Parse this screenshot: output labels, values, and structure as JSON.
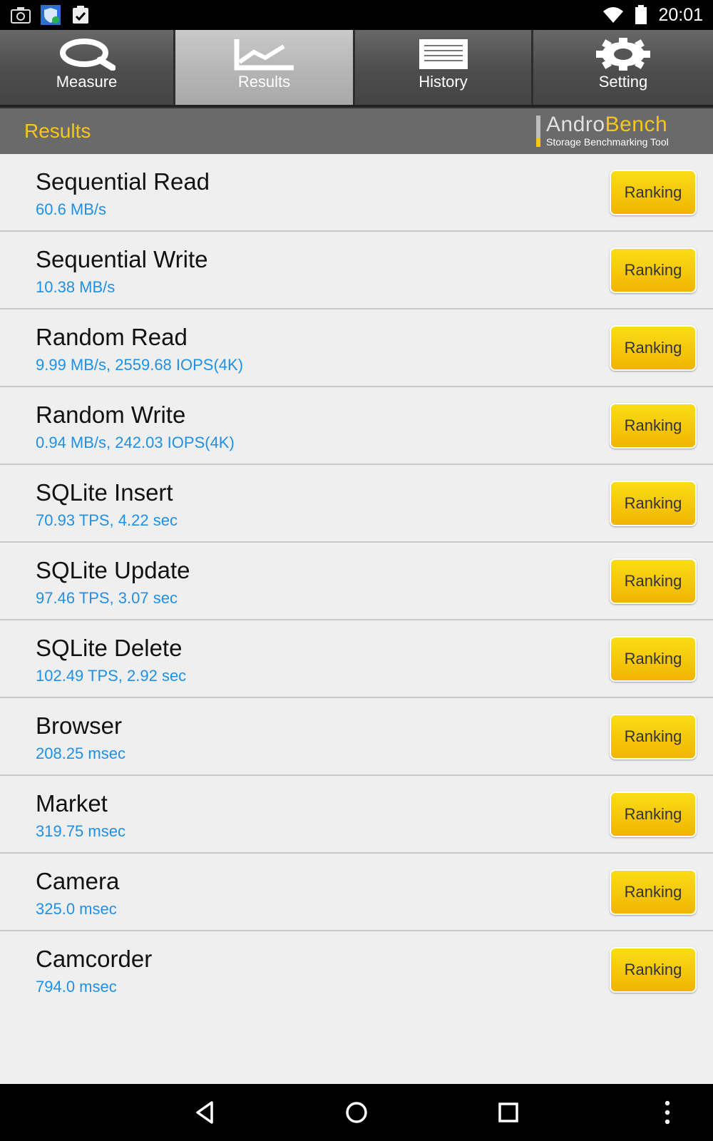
{
  "status_bar": {
    "time": "20:01",
    "left_icons": [
      "camera-icon",
      "shield-icon",
      "clipboard-check-icon"
    ],
    "right_icons": [
      "wifi-icon",
      "battery-icon"
    ]
  },
  "tabs": [
    {
      "label": "Measure",
      "icon": "search-icon",
      "active": false
    },
    {
      "label": "Results",
      "icon": "chart-icon",
      "active": true
    },
    {
      "label": "History",
      "icon": "list-icon",
      "active": false
    },
    {
      "label": "Setting",
      "icon": "gear-icon",
      "active": false
    }
  ],
  "header": {
    "title": "Results",
    "brand_part1": "Andro",
    "brand_part2": "Bench",
    "brand_tagline": "Storage Benchmarking Tool"
  },
  "results": [
    {
      "name": "Sequential Read",
      "value": "60.6 MB/s",
      "button": "Ranking"
    },
    {
      "name": "Sequential Write",
      "value": "10.38 MB/s",
      "button": "Ranking"
    },
    {
      "name": "Random Read",
      "value": "9.99 MB/s, 2559.68 IOPS(4K)",
      "button": "Ranking"
    },
    {
      "name": "Random Write",
      "value": "0.94 MB/s, 242.03 IOPS(4K)",
      "button": "Ranking"
    },
    {
      "name": "SQLite Insert",
      "value": "70.93 TPS, 4.22 sec",
      "button": "Ranking"
    },
    {
      "name": "SQLite Update",
      "value": "97.46 TPS, 3.07 sec",
      "button": "Ranking"
    },
    {
      "name": "SQLite Delete",
      "value": "102.49 TPS, 2.92 sec",
      "button": "Ranking"
    },
    {
      "name": "Browser",
      "value": "208.25 msec",
      "button": "Ranking"
    },
    {
      "name": "Market",
      "value": "319.75 msec",
      "button": "Ranking"
    },
    {
      "name": "Camera",
      "value": "325.0 msec",
      "button": "Ranking"
    },
    {
      "name": "Camcorder",
      "value": "794.0 msec",
      "button": "Ranking"
    }
  ],
  "nav_bar": [
    "back-icon",
    "home-icon",
    "recents-icon",
    "overflow-menu-icon"
  ],
  "colors": {
    "accent_yellow": "#f6c71a",
    "value_blue": "#1e90e8",
    "list_background": "#efefef"
  }
}
